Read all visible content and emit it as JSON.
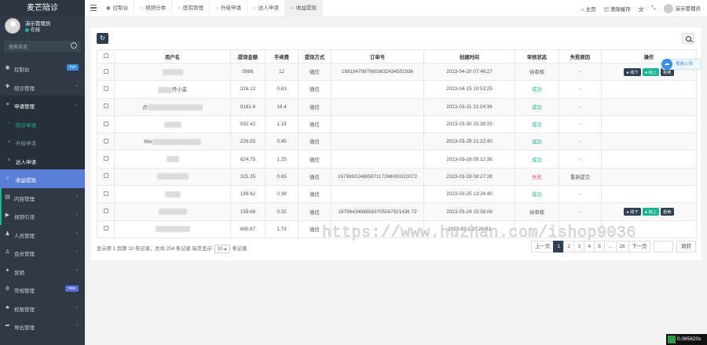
{
  "brand": "麦芒陪诊",
  "user": {
    "name": "演示管理员",
    "status": "在线"
  },
  "sidebar_search": {
    "placeholder": "搜索菜单"
  },
  "menu": [
    {
      "label": "控制台",
      "icon": "dashboard-icon",
      "badge": "hot",
      "badge_color": "#3a8ee6"
    },
    {
      "label": "陪诊管理",
      "icon": "hospital-icon"
    },
    {
      "label": "申请管理",
      "icon": "list-icon",
      "open": true
    },
    {
      "label": "陪诊申请",
      "icon": "circle-icon",
      "sub": true
    },
    {
      "label": "升级申请",
      "icon": "circle-icon",
      "sub": true
    },
    {
      "label": "达人申请",
      "icon": "circle-icon",
      "sub": true
    },
    {
      "label": "收益提现",
      "icon": "circle-icon",
      "sub": true,
      "active": true
    },
    {
      "label": "内容管理",
      "icon": "file-icon"
    },
    {
      "label": "视频引流",
      "icon": "video-icon"
    },
    {
      "label": "人员管理",
      "icon": "user-icon"
    },
    {
      "label": "会员管理",
      "icon": "member-icon"
    },
    {
      "label": "营销",
      "icon": "marketing-icon"
    },
    {
      "label": "常规管理",
      "icon": "gear-icon",
      "badge": "new",
      "badge_color": "#5a6fd8"
    },
    {
      "label": "权限管理",
      "icon": "group-icon"
    },
    {
      "label": "导出管理",
      "icon": "export-icon"
    }
  ],
  "tabs": [
    "控制台",
    "视频分类",
    "医院管理",
    "升级申请",
    "达人申请",
    "收益提现"
  ],
  "tools": {
    "home": "主页",
    "clear_cache": "清除缓存",
    "admin": "演示管理员"
  },
  "table": {
    "headers": [
      "用户名",
      "提现金额",
      "手续费",
      "提现方式",
      "订单号",
      "创建时间",
      "审核状态",
      "失败原因",
      "操作"
    ],
    "rows": [
      {
        "user": "",
        "amount": "5986",
        "fee": "12",
        "method": "微信",
        "order": "16819479876603632434551936",
        "time": "2023-04-20 07:46:27",
        "status": "待审核",
        "reason": "-",
        "ops": true
      },
      {
        "user": "丹小蛮",
        "amount": "316.12",
        "fee": "0.63",
        "method": "微信",
        "order": "",
        "time": "2023-04-15 10:53:25",
        "status": "成功",
        "reason": "-",
        "ops": false
      },
      {
        "user": "点",
        "amount": "9181.6",
        "fee": "18.4",
        "method": "微信",
        "order": "",
        "time": "2023-03-31 21:04:36",
        "status": "成功",
        "reason": "-",
        "ops": false
      },
      {
        "user": "",
        "amount": "592.42",
        "fee": "1.18",
        "method": "微信",
        "order": "",
        "time": "2023-03-30 20:38:25",
        "status": "成功",
        "reason": "-",
        "ops": false
      },
      {
        "user": "Mar",
        "amount": "226.55",
        "fee": "0.45",
        "method": "微信",
        "order": "",
        "time": "2023-03-28 21:22:40",
        "status": "成功",
        "reason": "-",
        "ops": false
      },
      {
        "user": "",
        "amount": "624.75",
        "fee": "1.25",
        "method": "微信",
        "order": "",
        "time": "2023-03-28 09:12:36",
        "status": "成功",
        "reason": "-",
        "ops": false
      },
      {
        "user": "",
        "amount": "325.35",
        "fee": "0.65",
        "method": "微信",
        "order": "16799632486597117266000323072",
        "time": "2023-03-28 08:27:28",
        "status": "失败",
        "reason": "重新提交",
        "ops": false
      },
      {
        "user": "",
        "amount": "189.62",
        "fee": "0.38",
        "method": "微信",
        "order": "",
        "time": "2023-03-25 13:24:40",
        "status": "成功",
        "reason": "-",
        "ops": false
      },
      {
        "user": "",
        "amount": "159.68",
        "fee": "0.32",
        "method": "微信",
        "order": "16796434886583705567921436 72",
        "time": "2023-03-24 15:38:08",
        "status": "待审核",
        "reason": "-",
        "ops": true
      },
      {
        "user": "",
        "amount": "865.67",
        "fee": "1.73",
        "method": "微信",
        "order": "",
        "time": "2023-03-1 17:20:51",
        "status": "",
        "reason": "-",
        "ops": false
      }
    ],
    "op_labels": [
      "线下",
      "线上",
      "拒绝"
    ]
  },
  "pager": {
    "info_before": "显示第 1 到第 10 条记录，总共 254 条记录 每页显示",
    "page_size": "10",
    "info_after": "条记录",
    "prev": "上一页",
    "pages": [
      "1",
      "2",
      "3",
      "4",
      "5",
      "...",
      "26"
    ],
    "next": "下一页",
    "go": "跳转"
  },
  "watermark": "https://www.huzhan.com/ishop9036",
  "float_button": "视频上传",
  "timer": "0.065820s"
}
